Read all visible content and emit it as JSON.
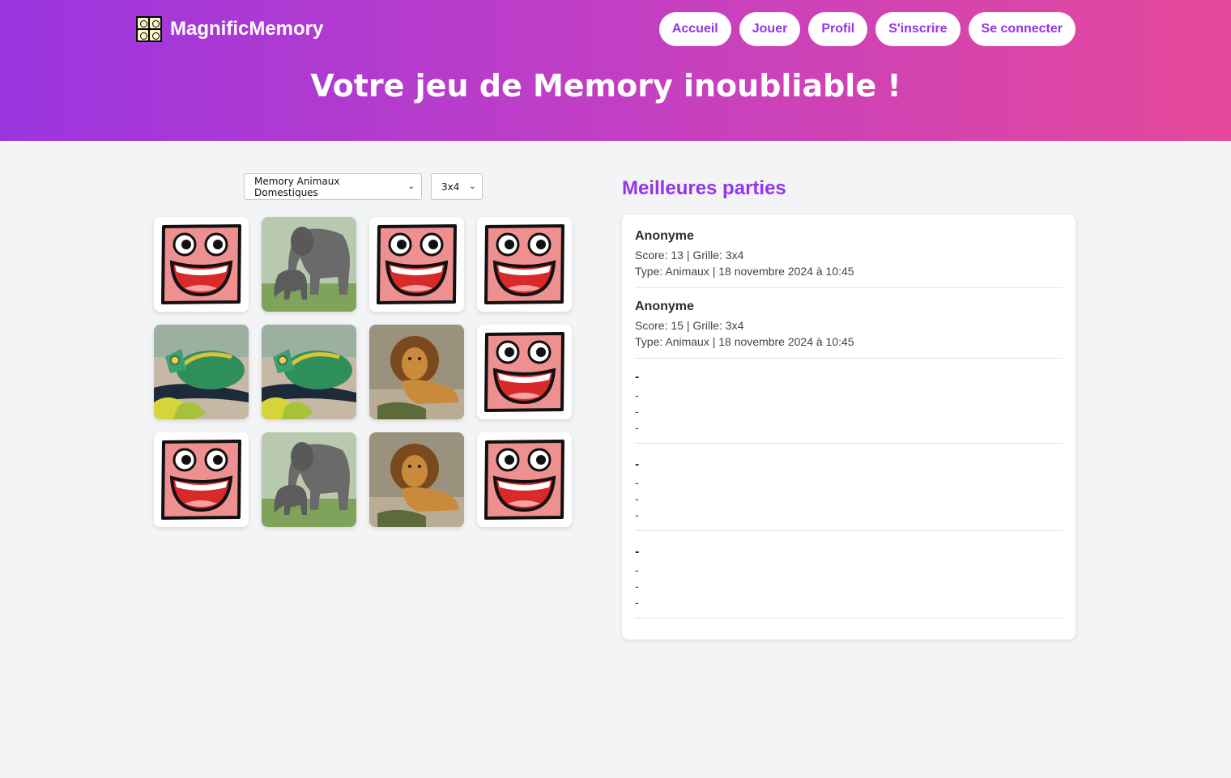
{
  "brand": {
    "name": "MagnificMemory",
    "logo_icon": "memory-grid-icon"
  },
  "nav": [
    {
      "label": "Accueil"
    },
    {
      "label": "Jouer"
    },
    {
      "label": "Profil"
    },
    {
      "label": "S'inscrire"
    },
    {
      "label": "Se connecter"
    }
  ],
  "hero": {
    "title": "Votre jeu de Memory inoubliable !"
  },
  "controls": {
    "game_select": {
      "value": "Memory Animaux Domestiques"
    },
    "grid_select": {
      "value": "3x4"
    }
  },
  "board": {
    "rows": 3,
    "cols": 4,
    "cards": [
      "back",
      "elephant",
      "back",
      "back",
      "chameleon",
      "chameleon",
      "lion",
      "back",
      "back",
      "elephant",
      "lion",
      "back"
    ]
  },
  "leaderboard": {
    "title": "Meilleures parties",
    "entries": [
      {
        "name": "Anonyme",
        "line1": "Score: 13 | Grille: 3x4",
        "line2": "Type: Animaux | 18 novembre 2024 à 10:45"
      },
      {
        "name": "Anonyme",
        "line1": "Score: 15 | Grille: 3x4",
        "line2": "Type: Animaux | 18 novembre 2024 à 10:45"
      }
    ],
    "empty_entries": [
      {
        "name": "-",
        "line1": "-",
        "line2": "-",
        "line3": "-"
      },
      {
        "name": "-",
        "line1": "-",
        "line2": "-",
        "line3": "-"
      },
      {
        "name": "-",
        "line1": "-",
        "line2": "-",
        "line3": "-"
      }
    ]
  }
}
